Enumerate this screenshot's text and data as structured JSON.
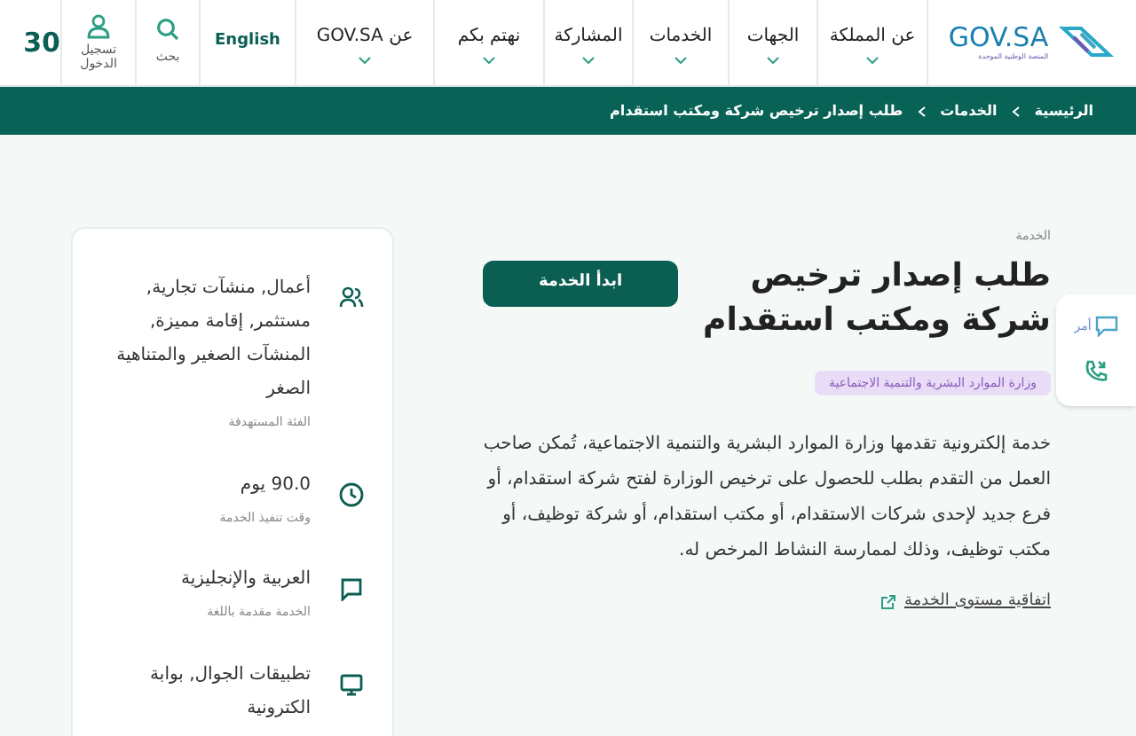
{
  "header": {
    "logo": {
      "name": "GOV.SA",
      "subtitle": "المنصة الوطنية الموحدة"
    },
    "nav": [
      {
        "label": "عن المملكة",
        "has_menu": true
      },
      {
        "label": "الجهات",
        "has_menu": true
      },
      {
        "label": "الخدمات",
        "has_menu": true
      },
      {
        "label": "المشاركة",
        "has_menu": true
      },
      {
        "label": "نهتم بكم",
        "has_menu": true
      },
      {
        "label": "عن GOV.SA",
        "has_menu": true
      }
    ],
    "language": "English",
    "search": "بحث",
    "login": "تسجيل الدخول",
    "vision_logo": "30"
  },
  "breadcrumb": [
    "الرئيسية",
    "الخدمات",
    "طلب إصدار ترخيص شركة ومكتب استقدام"
  ],
  "service": {
    "overline": "الخدمة",
    "title": "طلب إصدار ترخيص شركة ومكتب استقدام",
    "start_button": "ابدأ الخدمة",
    "agency_tag": "وزارة الموارد البشرية والتنمية الاجتماعية",
    "description": "خدمة إلكترونية تقدمها وزارة الموارد البشرية والتنمية الاجتماعية، تُمكن صاحب العمل من التقدم بطلب للحصول على ترخيص الوزارة لفتح شركة استقدام، أو فرع جديد لإحدى شركات الاستقدام، أو مكتب استقدام، أو شركة توظيف، أو مكتب توظيف، وذلك لممارسة النشاط المرخص له.",
    "sla_link": "اتفاقية مستوى الخدمة"
  },
  "details": [
    {
      "kind": "people",
      "value": "أعمال, منشآت تجارية, مستثمر, إقامة مميزة, المنشآت الصغير والمتناهية الصغر",
      "label": "الفئة المستهدفة"
    },
    {
      "kind": "clock",
      "value": "90.0 يوم",
      "label": "وقت تنفيذ الخدمة"
    },
    {
      "kind": "chat",
      "value": "العربية والإنجليزية",
      "label": "الخدمة مقدمة باللغة"
    },
    {
      "kind": "monitor",
      "value": "تطبيقات الجوال, بوابة الكترونية"
    }
  ],
  "floating_widget": {
    "chat_label": "أمر"
  }
}
